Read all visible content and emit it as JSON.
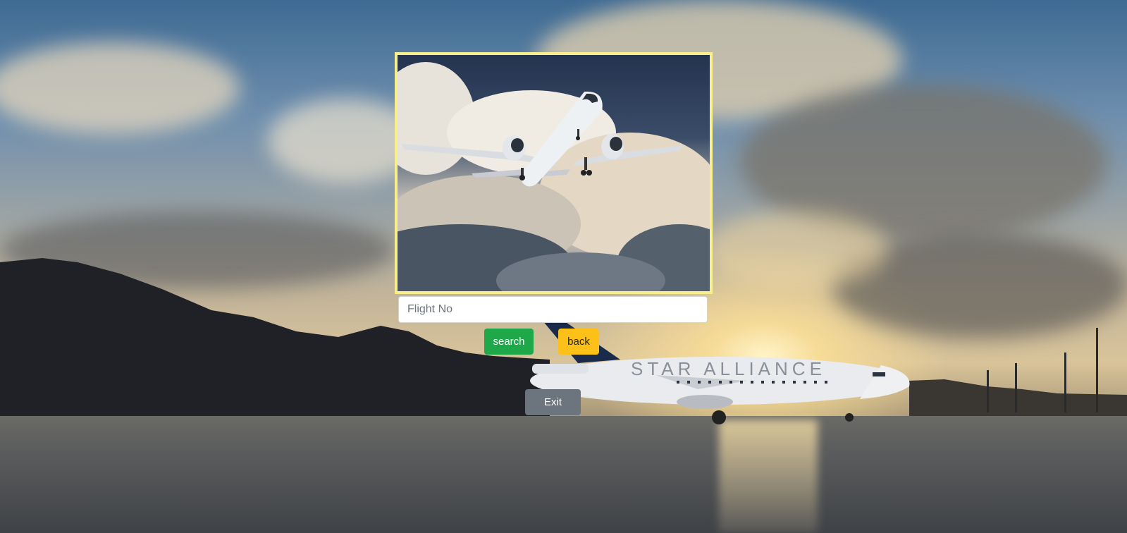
{
  "form": {
    "flight_placeholder": "Flight No",
    "flight_value": ""
  },
  "buttons": {
    "search_label": "search",
    "back_label": "back",
    "exit_label": "Exit"
  },
  "background": {
    "plane_livery_text": "STAR ALLIANCE"
  },
  "colors": {
    "frame_border": "#f8ee8c",
    "search_button": "#1ea84a",
    "back_button": "#fdc019",
    "exit_button": "#6c757d"
  }
}
